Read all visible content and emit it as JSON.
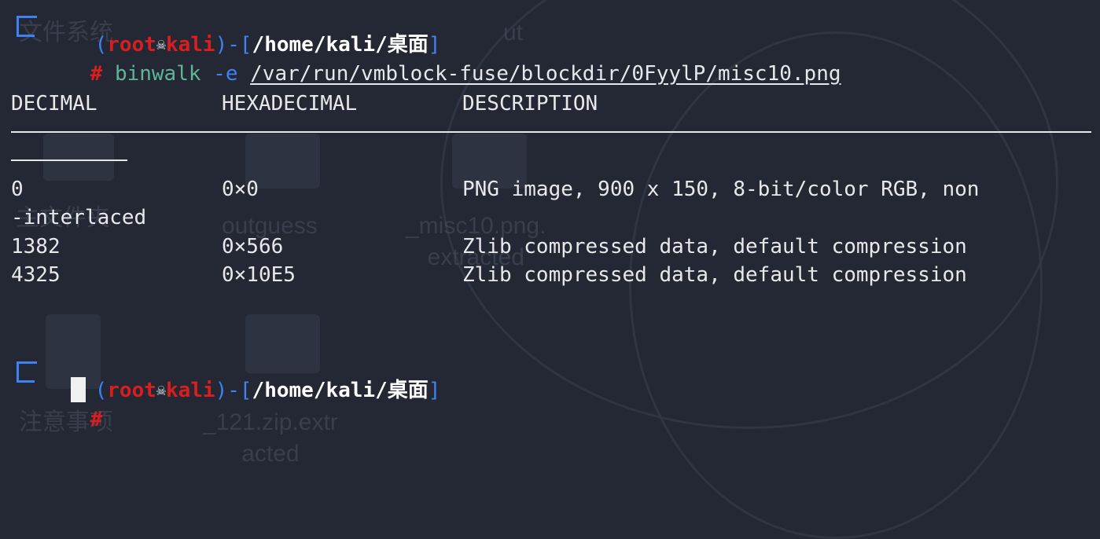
{
  "desktop_labels": {
    "tooltip": "文件系统",
    "outguess": "outguess",
    "misc10_line1": "_misc10.png.",
    "misc10_line2": "extracted",
    "notes": "注意事项",
    "zip_line1": "_121.zip.extr",
    "zip_line2": "acted",
    "homefolder": "主文件夹",
    "ext_label": "ut"
  },
  "prompt": {
    "open_paren": "(",
    "user": "root",
    "host": "kali",
    "separator": ")-[",
    "path": "/home/kali/桌面",
    "close_bracket": "]",
    "symbol": "#"
  },
  "command": {
    "program": "binwalk",
    "flag": "-e",
    "target": "/var/run/vmblock-fuse/blockdir/0FyylP/misc10.png"
  },
  "table": {
    "headers": [
      "DECIMAL",
      "HEXADECIMAL",
      "DESCRIPTION"
    ],
    "rows": [
      {
        "decimal": "0",
        "hex": "0×0",
        "description": "PNG image, 900 x 150, 8-bit/color RGB, non",
        "wrap": "-interlaced"
      },
      {
        "decimal": "1382",
        "hex": "0×566",
        "description": "Zlib compressed data, default compression"
      },
      {
        "decimal": "4325",
        "hex": "0×10E5",
        "description": "Zlib compressed data, default compression"
      }
    ]
  },
  "colors": {
    "background": "#242835",
    "prompt_frame": "#3d82f0",
    "user_host": "#d81e1e",
    "path": "#ffffff",
    "command": "#5fb598"
  }
}
